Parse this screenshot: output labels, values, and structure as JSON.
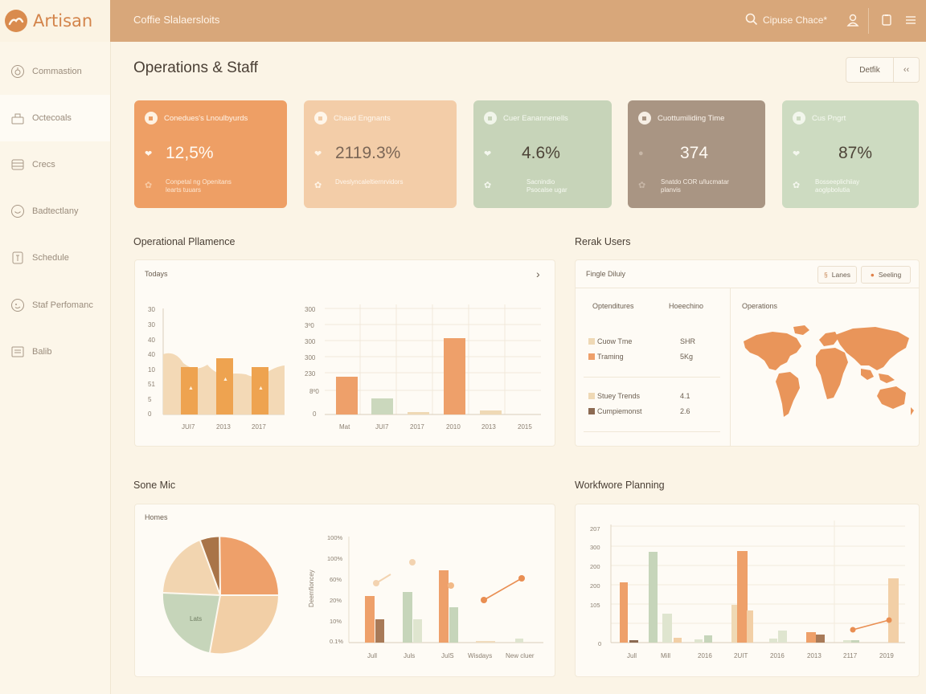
{
  "app": {
    "brand": "Artisan",
    "topbar_title": "Coffie Slalaersloits",
    "search_text": "Cipuse Chace*"
  },
  "nav": [
    {
      "label": "Commastion",
      "icon": "dial-icon"
    },
    {
      "label": "Octecoals",
      "icon": "briefcase-icon"
    },
    {
      "label": "Crecs",
      "icon": "stack-icon"
    },
    {
      "label": "Badtectlany",
      "icon": "smile-icon"
    },
    {
      "label": "Schedule",
      "icon": "document-icon"
    },
    {
      "label": "Staf Perfomanc",
      "icon": "face-icon"
    },
    {
      "label": "Balib",
      "icon": "list-icon"
    }
  ],
  "page": {
    "title": "Operations & Staff",
    "details_label": "Detfik",
    "expand_label": "‹‹"
  },
  "kpis": [
    {
      "title": "Conedues's Lnoulbyurds",
      "value": "12,5%",
      "sub": "Conpetal ng Openitans\nlearts tuuars",
      "bg": "#ee9f65"
    },
    {
      "title": "Chaad Engnants",
      "value": "2119.3%",
      "sub": "Dveslyncaleltiernrvidors",
      "bg": "#f3cda8"
    },
    {
      "title": "Cuer Eanannenells",
      "value": "4.6%",
      "sub": "Sacnindio\nPsocalse ugar",
      "bg": "#c7d4b9"
    },
    {
      "title": "Cuottumiliding Time",
      "value": "374",
      "sub": "Snatdo COR u/lucmatar\nplanvis",
      "bg": "#a99583"
    },
    {
      "title": "Cus Pngrt",
      "value": "87%",
      "sub": "Bosseeplichiiay\naoglpbolutia",
      "bg": "#cddbc1"
    }
  ],
  "ops": {
    "section_title": "Operational Pllamence",
    "panel_label": "Todays",
    "chart_left_yticks": [
      "30",
      "30",
      "40",
      "40",
      "10",
      "51",
      "5",
      "0"
    ],
    "chart_left_xticks": [
      "JUI7",
      "2013",
      "2017"
    ],
    "chart_right_yticks": [
      "300",
      "3º0",
      "300",
      "300",
      "230",
      "8º0",
      "0"
    ],
    "chart_right_xticks": [
      "Mat",
      "JUI7",
      "2017",
      "2010",
      "2013",
      "2015"
    ]
  },
  "users": {
    "section_title": "Rerak Users",
    "panel_label": "Fingle Diluiy",
    "btn_a": "Lanes",
    "btn_b": "Seeling",
    "col1": "Optenditures",
    "col2": "Hoeechino",
    "map_label": "Operations",
    "rows1": [
      {
        "label": "Cuow Tme",
        "value": "SHR",
        "color": "#efd9b5"
      },
      {
        "label": "Traming",
        "value": "5Kg",
        "color": "#eea06a"
      }
    ],
    "rows2": [
      {
        "label": "Stuey Trends",
        "value": "4.1",
        "color": "#efd9b5"
      },
      {
        "label": "Cumpiemonst",
        "value": "2.6",
        "color": "#8c6a52"
      }
    ]
  },
  "mix": {
    "section_title": "Sone Mic",
    "panel_label": "Homes",
    "pie_label": "Lats",
    "yticks": [
      "100%",
      "100%",
      "60%",
      "20%",
      "10%",
      "0.1%"
    ],
    "ylabel": "Deemfioncey",
    "xticks": [
      "Jull",
      "Juls",
      "JulS",
      "Wisdays",
      "New cluer"
    ]
  },
  "workforce": {
    "section_title": "Workfwore Planning",
    "yticks": [
      "207",
      "300",
      "200",
      "200",
      "105",
      "0"
    ],
    "xticks": [
      "Jull",
      "Mill",
      "2016",
      "2UIT",
      "2016",
      "2013",
      "2117",
      "2019"
    ]
  },
  "colors": {
    "orange": "#eea06a",
    "peach": "#f2cfa6",
    "sage": "#c6d5ba",
    "brown": "#8c6a52",
    "topbar": "#d8a77a"
  }
}
